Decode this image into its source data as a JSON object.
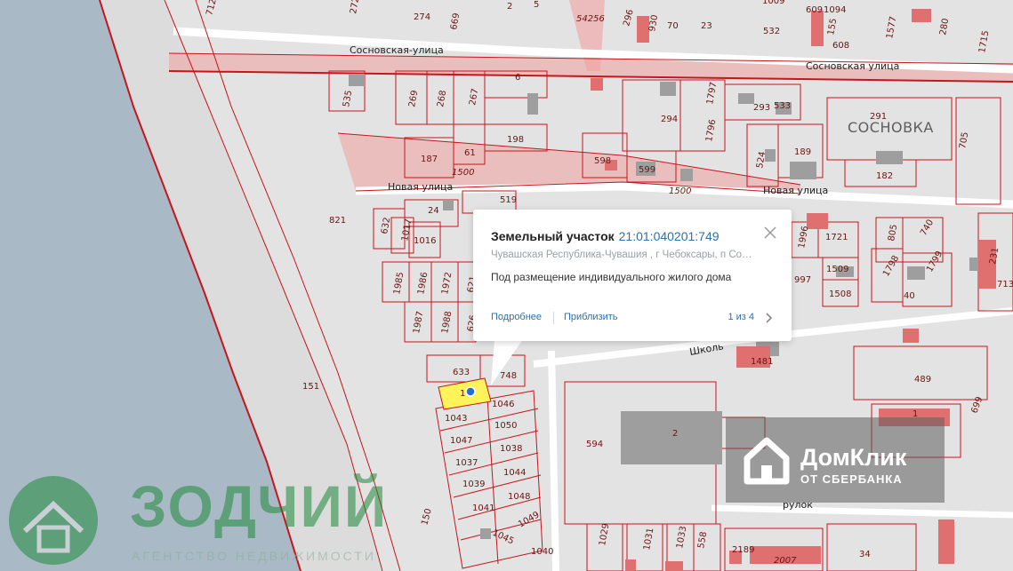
{
  "map": {
    "streets": [
      {
        "id": "sosnovskaya-west",
        "label": "Сосновская-улица"
      },
      {
        "id": "sosnovskaya-east",
        "label": "Сосновская улица"
      },
      {
        "id": "novaya-west",
        "label": "Новая улица"
      },
      {
        "id": "novaya-east",
        "label": "Новая улица"
      },
      {
        "id": "shkolny",
        "label": "Школь"
      },
      {
        "id": "pereulok",
        "label": "рулок"
      }
    ],
    "settlement_label": "СОСНОВКА",
    "zone_labels": [
      "1500",
      "1500",
      "54256"
    ],
    "parcels": [
      "712",
      "272",
      "274",
      "669",
      "2",
      "5",
      "296",
      "930",
      "70",
      "23",
      "532",
      "1009",
      "609",
      "1094",
      "155",
      "608",
      "1577",
      "280",
      "1715",
      "535",
      "269",
      "268",
      "267",
      "6",
      "1797",
      "294",
      "1796",
      "293",
      "533",
      "291",
      "705",
      "187",
      "61",
      "198",
      "598",
      "599",
      "524",
      "189",
      "182",
      "24",
      "519",
      "821",
      "632",
      "1017",
      "1016",
      "1996",
      "1721",
      "805",
      "740",
      "231",
      "1509",
      "1798",
      "1799",
      "713",
      "1508",
      "40",
      "997",
      "1985",
      "1986",
      "1972",
      "621",
      "1987",
      "1988",
      "626",
      "633",
      "748",
      "1481",
      "489",
      "1046",
      "1043",
      "1050",
      "1047",
      "1038",
      "1037",
      "1044",
      "1039",
      "1048",
      "1041",
      "1049",
      "1045",
      "1040",
      "151",
      "150",
      "594",
      "2",
      "1",
      "699",
      "1029",
      "1031",
      "1033",
      "558",
      "2189",
      "2007",
      "34"
    ],
    "selected_parcel_label": "1"
  },
  "popup": {
    "title_label": "Земельный участок",
    "cadastral_number": "21:01:040201:749",
    "address": "Чувашская Республика-Чувашия , г Чебоксары, п Со…",
    "description": "Под размещение индивидуального жилого дома",
    "more_link": "Подробнее",
    "zoom_link": "Приблизить",
    "pager": "1 из 4"
  },
  "watermarks": {
    "domclick_title": "ДомКлик",
    "domclick_sub": "ОТ СБЕРБАНКА",
    "zodchiy_title": "ЗОДЧИЙ",
    "zodchiy_sub": "АГЕНТСТВО НЕДВИЖИМОСТИ"
  },
  "colors": {
    "parcel_border": "#c4161c",
    "selected_parcel_fill": "#fff35a",
    "zone_fill": "#f2a0a0",
    "water": "#a9b9c6",
    "link": "#2a6fb0",
    "marker": "#1f6fd1"
  }
}
